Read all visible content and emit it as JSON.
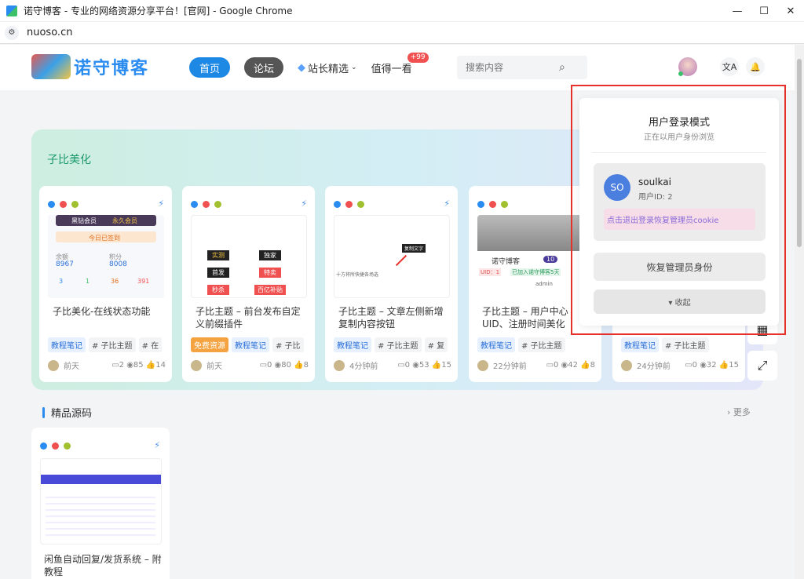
{
  "window": {
    "title": "诺守博客 - 专业的网络资源分享平台！[官网] - Google Chrome",
    "url": "nuoso.cn",
    "minimize": "—",
    "maximize": "☐",
    "close": "✕"
  },
  "header": {
    "logo_text": "诺守博客",
    "nav": {
      "home": "首页",
      "forum": "论坛",
      "picks": "站长精选",
      "worth": "值得一看",
      "worth_badge": "+99"
    },
    "search_placeholder": "搜索内容",
    "translate_icon": "文A",
    "bell_icon": "🔔"
  },
  "band": {
    "title": "子比美化",
    "cards": [
      {
        "title": "子比美化-在线状态功能",
        "tags": [
          "教程笔记",
          "# 子比主题",
          "# 在"
        ],
        "tag_styles": [
          "blue",
          "",
          ""
        ],
        "time": "前天",
        "stats": "▭2 ◉85 👍14",
        "thumb": {
          "vip": "黑钻会员",
          "club": "永久会员",
          "signin": "今日已签到",
          "balance_label": "余额",
          "balance": "8967",
          "points_label": "积分",
          "points": "8008",
          "c1": "3",
          "c2": "1",
          "c3": "36",
          "c4": "391"
        }
      },
      {
        "title": "子比主题 – 前台发布自定义前缀插件",
        "tags": [
          "免费资源",
          "教程笔记",
          "# 子比"
        ],
        "tag_styles": [
          "orange",
          "blue",
          ""
        ],
        "time": "前天",
        "stats": "▭0 ◉80 👍8",
        "thumb": {
          "b1": "实测",
          "b2": "独家",
          "b3": "首发",
          "b4": "特卖",
          "b5": "秒杀",
          "b6": "百亿补贴"
        }
      },
      {
        "title": "子比主题 – 文章左侧新增复制内容按钮",
        "tags": [
          "教程笔记",
          "# 子比主题",
          "# 复"
        ],
        "tag_styles": [
          "blue",
          "",
          ""
        ],
        "time": "4分钟前",
        "stats": "▭0 ◉53 👍15",
        "thumb": {
          "tip": "复制文字",
          "line": "十方将所快捷各场选"
        }
      },
      {
        "title": "子比主题 – 用户中心UID、注册时间美化",
        "tags": [
          "教程笔记",
          "# 子比主题"
        ],
        "tag_styles": [
          "blue",
          ""
        ],
        "time": "22分钟前",
        "stats": "▭0 ◉42 👍8",
        "thumb": {
          "name": "诺守博客",
          "lv": "10",
          "uid": "UID：1",
          "joined": "已加入诺守博客5天",
          "admin": "admin"
        }
      },
      {
        "title": "",
        "tags": [
          "教程笔记",
          "# 子比主题"
        ],
        "tag_styles": [
          "blue",
          ""
        ],
        "time": "24分钟前",
        "stats": "▭0 ◉32 👍15",
        "thumb": {}
      }
    ]
  },
  "section2": {
    "title": "精品源码",
    "more": "› 更多",
    "cards": [
      {
        "title": "闲鱼自动回复/发货系统 – 附教程"
      }
    ]
  },
  "popup": {
    "title": "用户登录模式",
    "subtitle": "正在以用户身份浏览",
    "user_initials": "SO",
    "username": "soulkai",
    "user_id": "用户ID: 2",
    "logout_link": "点击退出登录恢复管理员cookie",
    "restore_button": "恢复管理员身份",
    "collapse_button": "▾ 收起"
  },
  "colors": {
    "accent": "#1e88e5",
    "highlight": "#e8302a",
    "band_start": "#cdeee0",
    "band_end": "#e3e6f8"
  }
}
